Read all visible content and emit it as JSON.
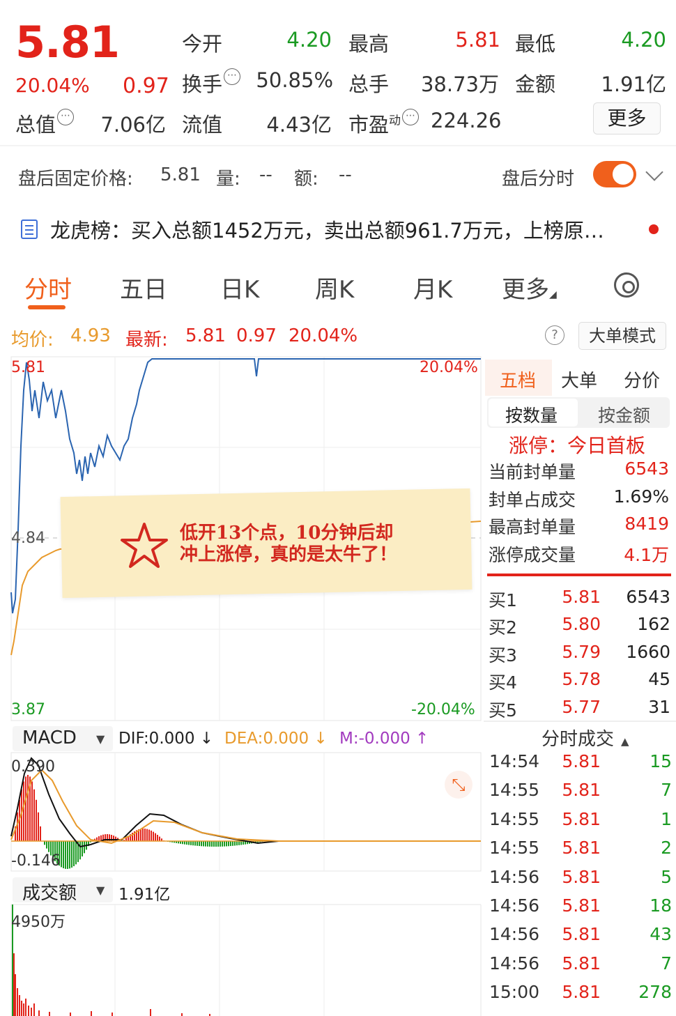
{
  "quote": {
    "price": "5.81",
    "change_pct": "20.04%",
    "change_amt": "0.97",
    "open_label": "今开",
    "open": "4.20",
    "high_label": "最高",
    "high": "5.81",
    "low_label": "最低",
    "low": "4.20",
    "turnover_label": "换手",
    "turnover": "50.85%",
    "volume_label": "总手",
    "volume": "38.73万",
    "amount_label": "金额",
    "amount": "1.91亿",
    "mktcap_label": "总值",
    "mktcap": "7.06亿",
    "float_label": "流值",
    "float": "4.43亿",
    "pe_label": "市盈",
    "pe_sup": "动",
    "pe": "224.26",
    "more_button": "更多"
  },
  "after_hours": {
    "label": "盘后固定价格:",
    "price": "5.81",
    "vol_label": "量:",
    "vol": "--",
    "amt_label": "额:",
    "amt": "--",
    "toggle_label": "盘后分时",
    "toggle_on": true
  },
  "dragon_tiger": {
    "text": "龙虎榜：买入总额1452万元，卖出总额961.7万元，上榜原…"
  },
  "tabs": [
    {
      "label": "分时",
      "active": true
    },
    {
      "label": "五日"
    },
    {
      "label": "日K"
    },
    {
      "label": "周K"
    },
    {
      "label": "月K"
    },
    {
      "label": "更多"
    }
  ],
  "chart_header": {
    "avg_label": "均价:",
    "avg": "4.93",
    "latest_label": "最新:",
    "latest": "5.81",
    "chg": "0.97",
    "chg_pct": "20.04%",
    "help": "?",
    "mode_button": "大单模式"
  },
  "chart_labels": {
    "top_price": "5.81",
    "mid_price": "4.84",
    "bottom_price": "3.87",
    "top_pct": "20.04%",
    "bottom_pct": "-20.04%"
  },
  "note": {
    "line1": "低开13个点，10分钟后却",
    "line2": "冲上涨停，真的是太牛了！"
  },
  "right_panel": {
    "tabs": [
      "五档",
      "大单",
      "分价"
    ],
    "seg": [
      "按数量",
      "按金额"
    ],
    "limit_title": "涨停：今日首板",
    "kv": [
      {
        "label": "当前封单量",
        "value": "6543",
        "color": "#e2231a"
      },
      {
        "label": "封单占成交",
        "value": "1.69%",
        "color": "#222222"
      },
      {
        "label": "最高封单量",
        "value": "8419",
        "color": "#e2231a"
      },
      {
        "label": "涨停成交量",
        "value": "4.1万",
        "color": "#e2231a"
      }
    ],
    "bids": [
      {
        "label": "买1",
        "price": "5.81",
        "vol": "6543"
      },
      {
        "label": "买2",
        "price": "5.80",
        "vol": "162"
      },
      {
        "label": "买3",
        "price": "5.79",
        "vol": "1660"
      },
      {
        "label": "买4",
        "price": "5.78",
        "vol": "45"
      },
      {
        "label": "买5",
        "price": "5.77",
        "vol": "31"
      }
    ],
    "ticks_title": "分时成交",
    "ticks": [
      {
        "time": "14:54",
        "price": "5.81",
        "vol": "15"
      },
      {
        "time": "14:55",
        "price": "5.81",
        "vol": "7"
      },
      {
        "time": "14:55",
        "price": "5.81",
        "vol": "1"
      },
      {
        "time": "14:55",
        "price": "5.81",
        "vol": "2"
      },
      {
        "time": "14:56",
        "price": "5.81",
        "vol": "5"
      },
      {
        "time": "14:56",
        "price": "5.81",
        "vol": "18"
      },
      {
        "time": "14:56",
        "price": "5.81",
        "vol": "43"
      },
      {
        "time": "14:56",
        "price": "5.81",
        "vol": "7"
      },
      {
        "time": "15:00",
        "price": "5.81",
        "vol": "278"
      }
    ]
  },
  "macd": {
    "selector": "MACD",
    "dif": "DIF:0.000 ↓",
    "dea": "DEA:0.000 ↓",
    "m": "M:-0.000 ↑",
    "top": "0.390",
    "bottom": "-0.146"
  },
  "volume": {
    "selector": "成交额",
    "total": "1.91亿",
    "top": "4950万"
  },
  "colors": {
    "up": "#e2231a",
    "down": "#1a9a22",
    "accent": "#f0601c",
    "price_line": "#2a64b0",
    "avg_line": "#e89a2c"
  }
}
